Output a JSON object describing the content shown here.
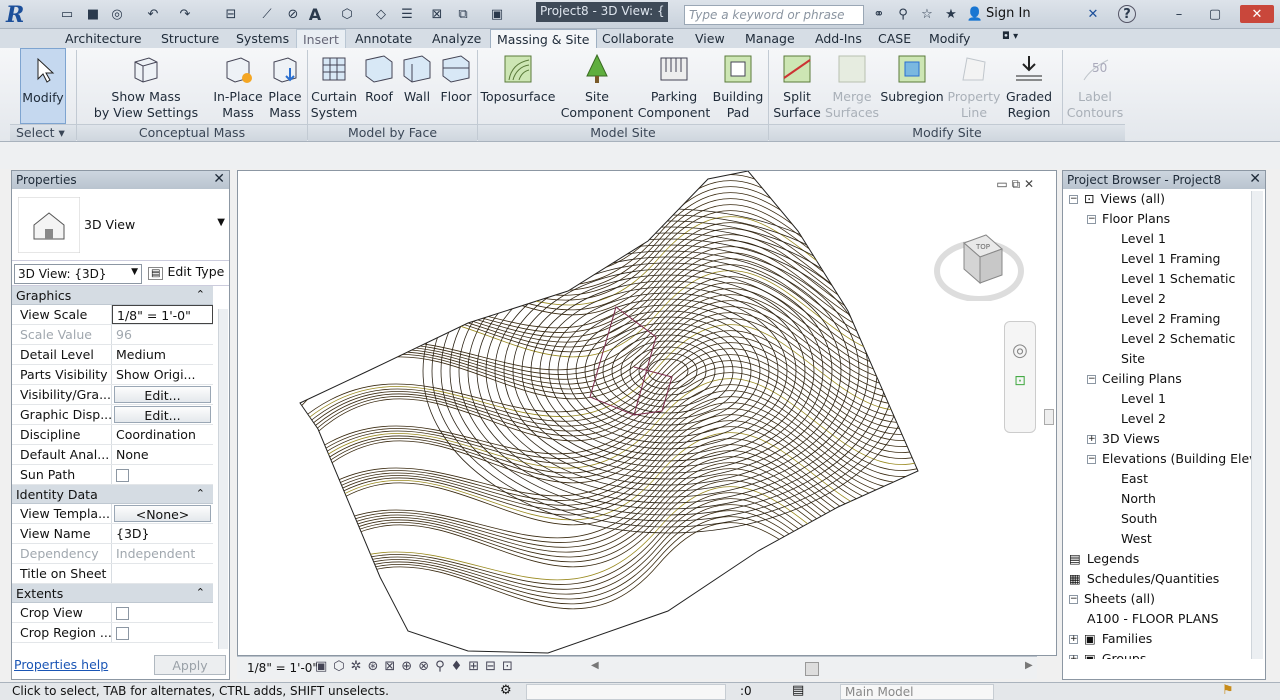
{
  "qat": {
    "logo": "R",
    "title": "Project8 - 3D View: {",
    "search_placeholder": "Type a keyword or phrase",
    "sign_in": "Sign In",
    "help": "?"
  },
  "tabs": [
    "Architecture",
    "Structure",
    "Systems",
    "Insert",
    "Annotate",
    "Analyze",
    "Massing & Site",
    "Collaborate",
    "View",
    "Manage",
    "Add-Ins",
    "CASE",
    "Modify"
  ],
  "ribbon": {
    "modify": "Modify",
    "show_mass": [
      "Show Mass",
      "by View Settings"
    ],
    "in_place": [
      "In-Place",
      "Mass"
    ],
    "place_mass": [
      "Place",
      "Mass"
    ],
    "curtain": [
      "Curtain",
      "System"
    ],
    "roof": "Roof",
    "wall": "Wall",
    "floor": "Floor",
    "toposurface": "Toposurface",
    "site_comp": [
      "Site",
      "Component"
    ],
    "parking": [
      "Parking",
      "Component"
    ],
    "building_pad": [
      "Building",
      "Pad"
    ],
    "split": [
      "Split",
      "Surface"
    ],
    "merge": [
      "Merge",
      "Surfaces"
    ],
    "subregion": "Subregion",
    "property_line": [
      "Property",
      "Line"
    ],
    "graded": [
      "Graded",
      "Region"
    ],
    "label_contours": [
      "Label",
      "Contours"
    ],
    "panels": {
      "select": "Select",
      "conceptual": "Conceptual Mass",
      "model_face": "Model by Face",
      "model_site": "Model Site",
      "modify_site": "Modify Site"
    }
  },
  "properties": {
    "title": "Properties",
    "type": "3D View",
    "selector": "3D View: {3D}",
    "edit_type": "Edit Type",
    "groups": [
      {
        "name": "Graphics",
        "rows": [
          [
            "View Scale",
            "1/8\" = 1'-0\""
          ],
          [
            "Scale Value",
            "96"
          ],
          [
            "Detail Level",
            "Medium"
          ],
          [
            "Parts Visibility",
            "Show Origi..."
          ],
          [
            "Visibility/Gra...",
            "Edit..."
          ],
          [
            "Graphic Disp...",
            "Edit..."
          ],
          [
            "Discipline",
            "Coordination"
          ],
          [
            "Default Anal...",
            "None"
          ],
          [
            "Sun Path",
            ""
          ]
        ]
      },
      {
        "name": "Identity Data",
        "rows": [
          [
            "View Templa...",
            "<None>"
          ],
          [
            "View Name",
            "{3D}"
          ],
          [
            "Dependency",
            "Independent"
          ],
          [
            "Title on Sheet",
            ""
          ]
        ]
      },
      {
        "name": "Extents",
        "rows": [
          [
            "Crop View",
            ""
          ],
          [
            "Crop Region ...",
            ""
          ]
        ]
      }
    ],
    "help": "Properties help",
    "apply": "Apply"
  },
  "browser": {
    "title": "Project Browser - Project8",
    "items": [
      {
        "t": "Views (all)",
        "l": 0
      },
      {
        "t": "Floor Plans",
        "l": 1
      },
      {
        "t": "Level 1",
        "l": 2
      },
      {
        "t": "Level 1 Framing",
        "l": 2
      },
      {
        "t": "Level 1 Schematic",
        "l": 2
      },
      {
        "t": "Level 2",
        "l": 2
      },
      {
        "t": "Level 2 Framing",
        "l": 2
      },
      {
        "t": "Level 2 Schematic",
        "l": 2
      },
      {
        "t": "Site",
        "l": 2
      },
      {
        "t": "Ceiling Plans",
        "l": 1
      },
      {
        "t": "Level 1",
        "l": 2
      },
      {
        "t": "Level 2",
        "l": 2
      },
      {
        "t": "3D Views",
        "l": 1
      },
      {
        "t": "Elevations (Building Elev",
        "l": 1
      },
      {
        "t": "East",
        "l": 2
      },
      {
        "t": "North",
        "l": 2
      },
      {
        "t": "South",
        "l": 2
      },
      {
        "t": "West",
        "l": 2
      },
      {
        "t": "Legends",
        "l": 0
      },
      {
        "t": "Schedules/Quantities",
        "l": 0
      },
      {
        "t": "Sheets (all)",
        "l": 0
      },
      {
        "t": "A100 - FLOOR PLANS",
        "l": 1
      },
      {
        "t": "Families",
        "l": 0
      },
      {
        "t": "Groups",
        "l": 0
      }
    ]
  },
  "view": {
    "scale": "1/8\" = 1'-0\"",
    "cube": "TOP"
  },
  "status": {
    "hint": "Click to select, TAB for alternates, CTRL adds, SHIFT unselects.",
    "count": ":0",
    "model": "Main Model"
  }
}
